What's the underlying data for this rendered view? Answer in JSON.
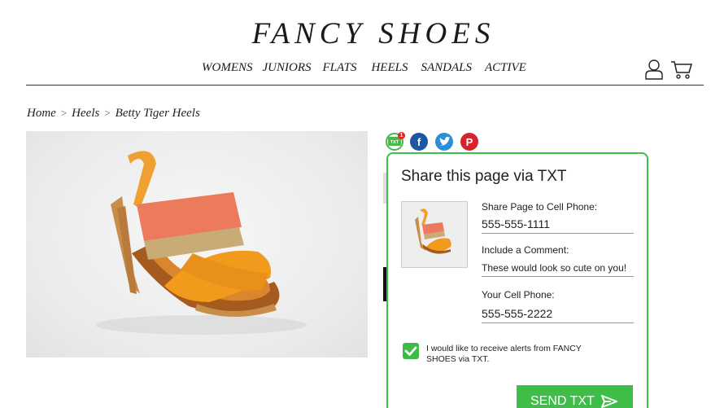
{
  "header": {
    "brand": "FANCY SHOES",
    "nav": [
      "WOMENS",
      "JUNIORS",
      "FLATS",
      "HEELS",
      "SANDALS",
      "ACTIVE"
    ],
    "icons": [
      "user-icon",
      "cart-icon"
    ]
  },
  "breadcrumb": {
    "items": [
      "Home",
      "Heels",
      "Betty Tiger Heels"
    ],
    "separator": ">"
  },
  "social": {
    "icons": [
      "txt-icon",
      "facebook-icon",
      "twitter-icon",
      "pinterest-icon"
    ],
    "txt_badge": "1",
    "txt_icon_label": "TXT",
    "facebook_glyph": "f",
    "pinterest_glyph": "P"
  },
  "share_popup": {
    "title": "Share this page via TXT",
    "share_label": "Share Page to Cell Phone:",
    "share_value": "555-555-1111",
    "comment_label": "Include a Comment:",
    "comment_value": "These would look so cute on you!",
    "your_phone_label": "Your Cell Phone:",
    "your_phone_value": "555-555-2222",
    "opt_in_checked": true,
    "opt_in_label": "I would like to receive alerts from FANCY SHOES via TXT.",
    "send_label": "SEND TXT"
  },
  "colors": {
    "accent_green": "#3ebe48",
    "facebook": "#1d56a3",
    "twitter": "#2a8fd7",
    "pinterest": "#d8232a"
  }
}
